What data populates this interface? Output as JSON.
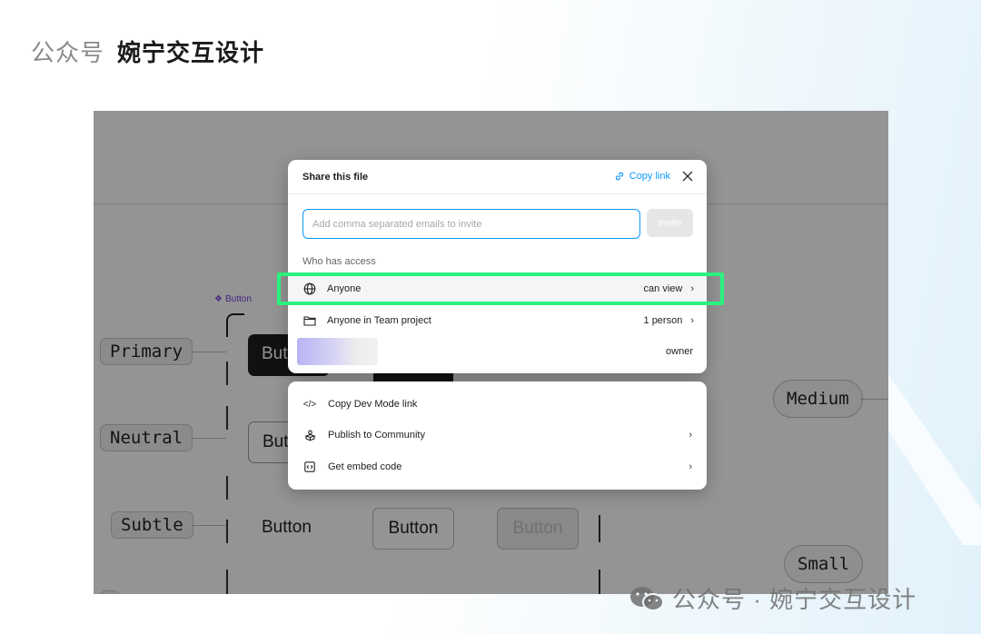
{
  "header": {
    "prefix": "公众号",
    "name": "婉宁交互设计"
  },
  "canvas": {
    "component_tag": "Button",
    "row_labels": [
      "Primary",
      "Neutral",
      "Subtle"
    ],
    "button_label": "Button",
    "partial_button_label": "But",
    "size_labels": [
      "Medium",
      "Small"
    ]
  },
  "share_dialog": {
    "title": "Share this file",
    "copy_link": "Copy link",
    "email_placeholder": "Add comma separated emails to invite",
    "invite_label": "Invite",
    "who_has_access": "Who has access",
    "access_rows": [
      {
        "icon": "globe-icon",
        "label": "Anyone",
        "value": "can view"
      },
      {
        "icon": "folder-icon",
        "label": "Anyone in Team project",
        "value": "1 person"
      }
    ],
    "owner_label": "owner"
  },
  "more_menu": {
    "items": [
      {
        "icon": "code-icon",
        "label": "Copy Dev Mode link",
        "has_chevron": false
      },
      {
        "icon": "community-icon",
        "label": "Publish to Community",
        "has_chevron": true
      },
      {
        "icon": "embed-icon",
        "label": "Get embed code",
        "has_chevron": true
      }
    ]
  },
  "watermark": {
    "text": "公众号 · 婉宁交互设计"
  },
  "colors": {
    "accent": "#0d99ff",
    "highlight": "#2bf27e",
    "component_purple": "#7b3fe4"
  }
}
